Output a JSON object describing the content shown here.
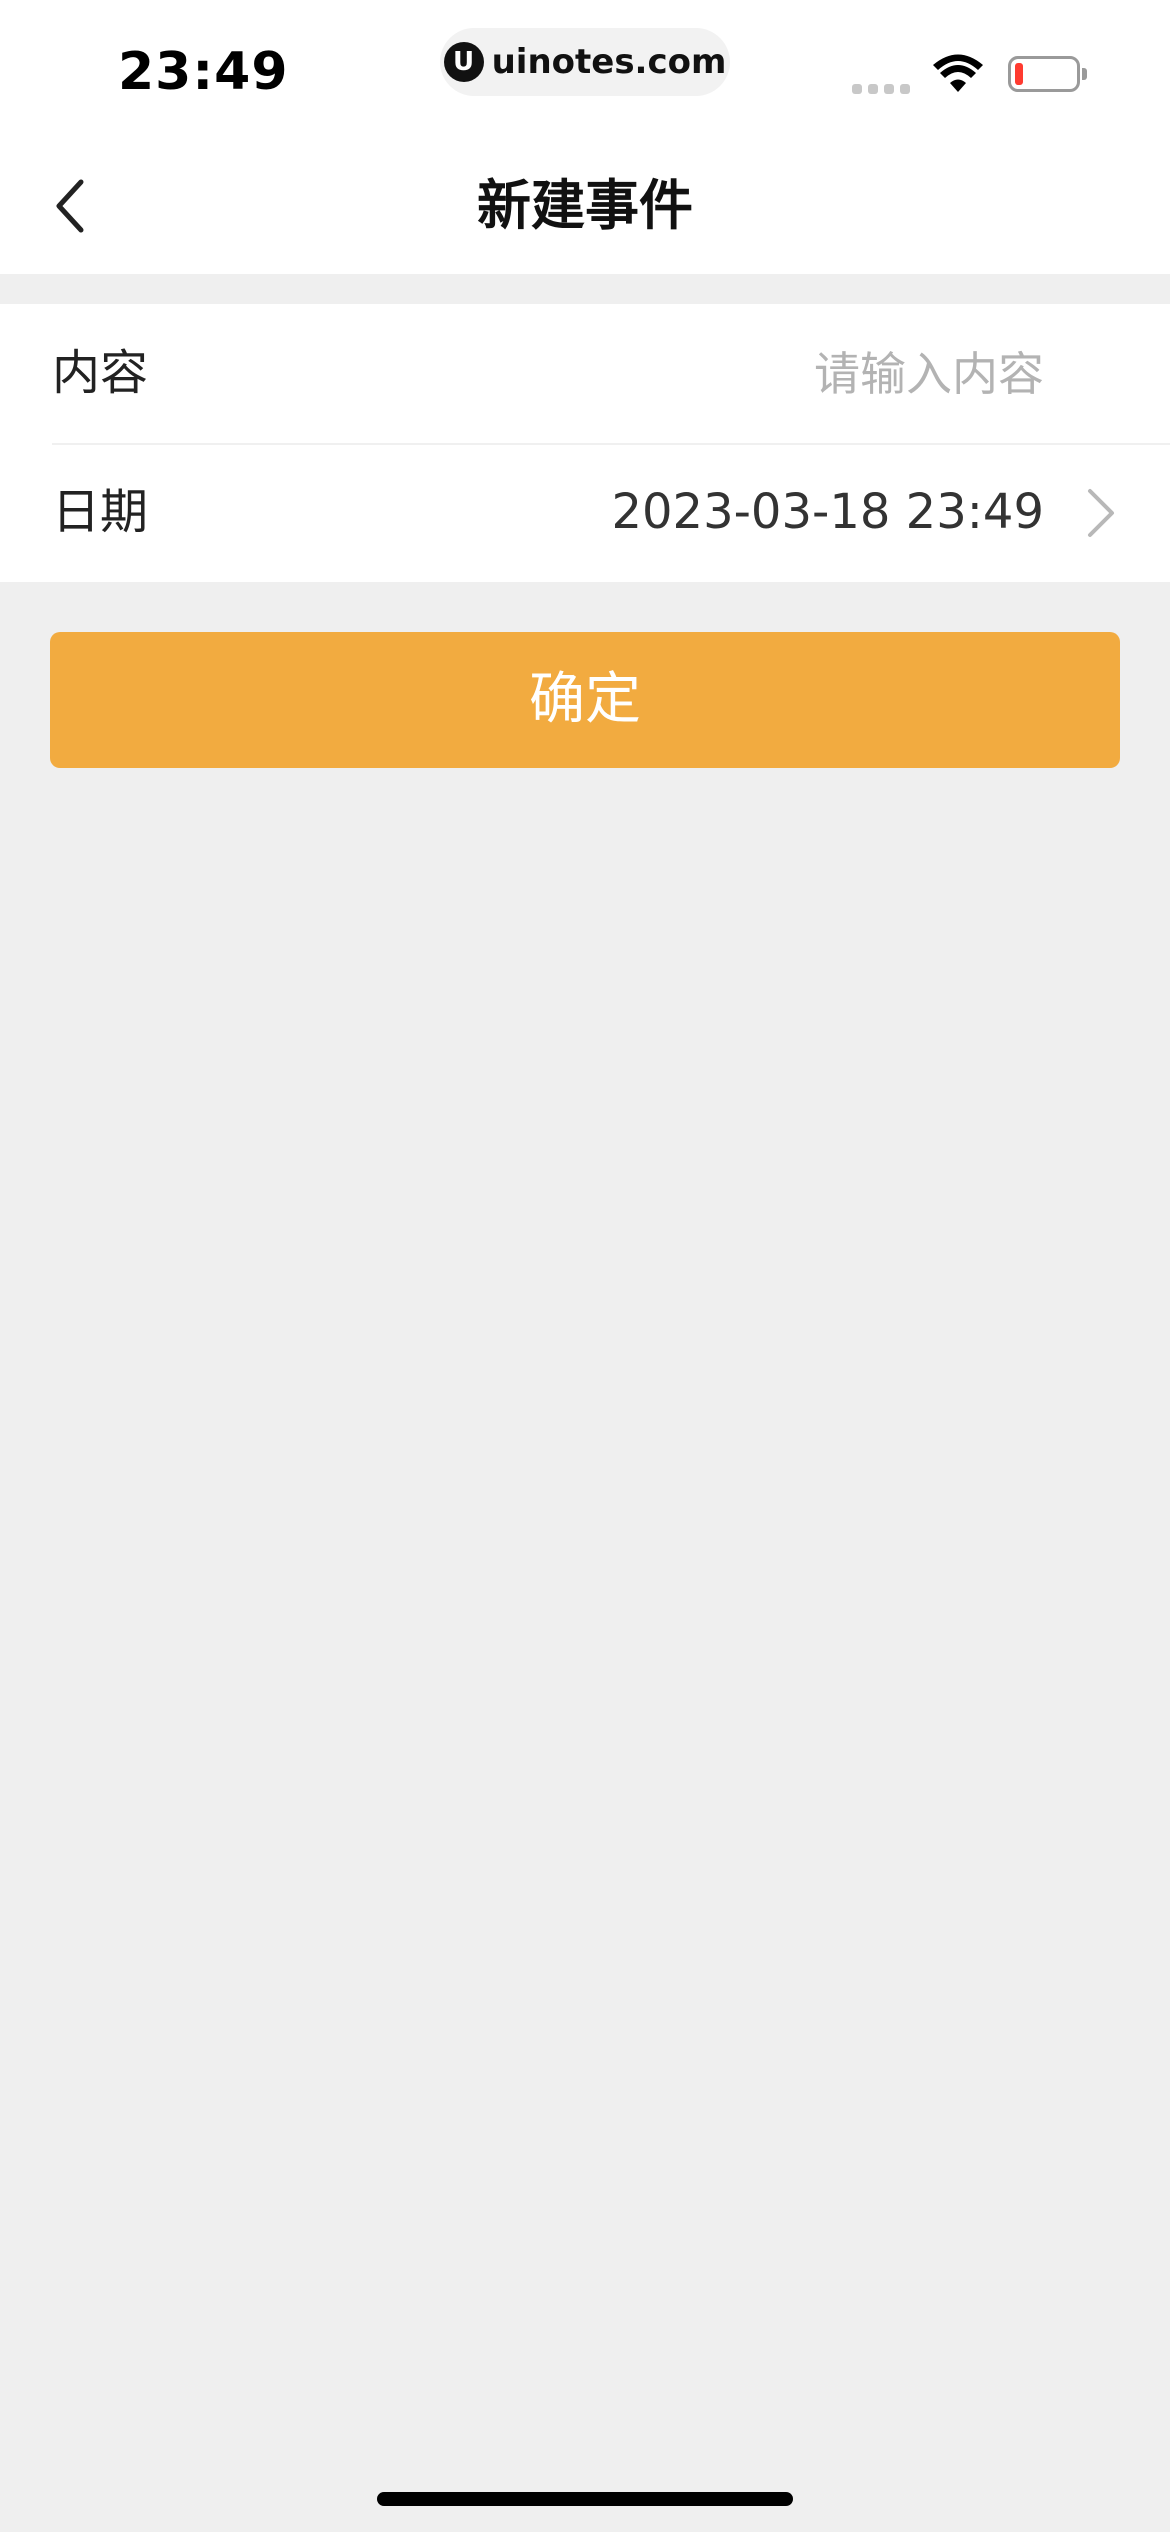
{
  "status_bar": {
    "time": "23:49",
    "url_logo": "U",
    "url": "uinotes.com",
    "icons": [
      "signal-icon",
      "wifi-icon",
      "battery-icon"
    ],
    "battery_color": "#ff3b30"
  },
  "nav": {
    "back_icon": "chevron-left-icon",
    "title": "新建事件"
  },
  "form": {
    "content_label": "内容",
    "content_value": "",
    "content_placeholder": "请输入内容",
    "date_label": "日期",
    "date_value": "2023-03-18 23:49",
    "date_icon": "chevron-right-icon"
  },
  "confirm_button": {
    "label": "确定",
    "color": "#f2ab40"
  },
  "colors": {
    "background": "#efefef",
    "surface": "#ffffff",
    "accent": "#f2ab40",
    "placeholder": "#b3b3b3"
  }
}
